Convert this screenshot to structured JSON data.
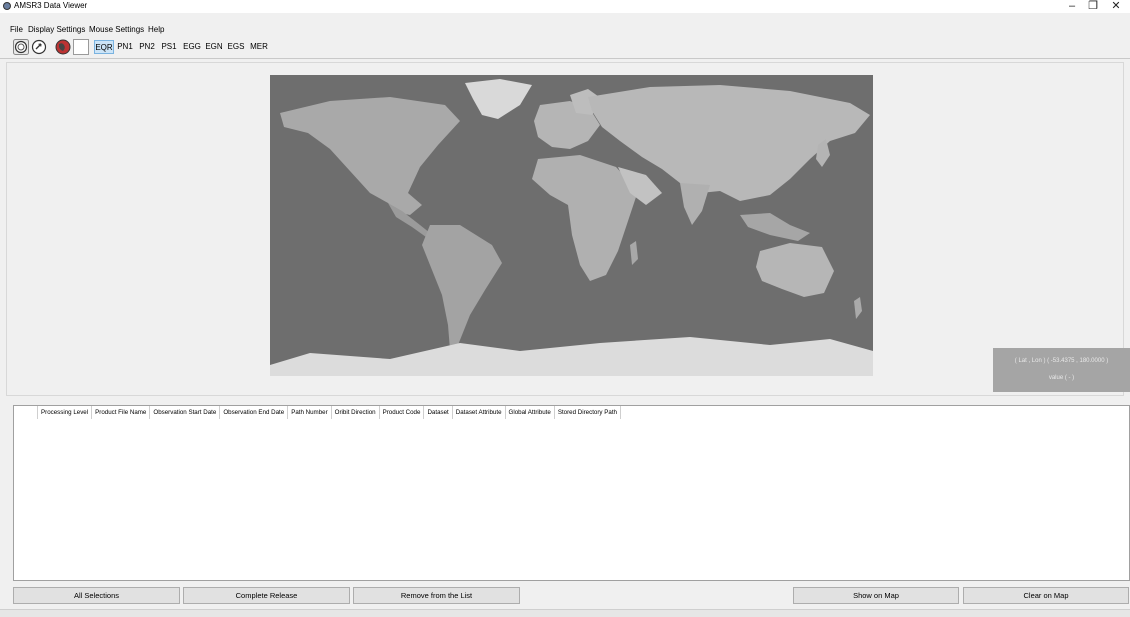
{
  "window": {
    "title": "AMSR3 Data Viewer",
    "controls": {
      "minimize": "–",
      "restore": "❐",
      "close": "✕"
    }
  },
  "menu": {
    "items": [
      {
        "label": "File"
      },
      {
        "label": "Display Settings"
      },
      {
        "label": "Mouse Settings"
      },
      {
        "label": "Help"
      }
    ]
  },
  "toolbar": {
    "icons": [
      "zoom-icon",
      "rotate-icon",
      "globe-icon",
      "blank-icon"
    ],
    "projections": [
      {
        "label": "EQR",
        "selected": true
      },
      {
        "label": "PN1"
      },
      {
        "label": "PN2"
      },
      {
        "label": "PS1"
      },
      {
        "label": "EGG"
      },
      {
        "label": "EGN"
      },
      {
        "label": "EGS"
      },
      {
        "label": "MER"
      }
    ]
  },
  "map": {
    "coord_text": "( Lat , Lon ) ( -53.4375 , 180.0000 )",
    "value_text": "value ( - )"
  },
  "table": {
    "columns": [
      "Processing Level",
      "Product File Name",
      "Observation Start Date",
      "Observation End Date",
      "Path Number",
      "Oribit Direction",
      "Product Code",
      "Dataset",
      "Dataset Attribute",
      "Global Attribute",
      "Stored Directory Path"
    ],
    "rows": []
  },
  "buttons": {
    "all_selections": "All Selections",
    "complete_release": "Complete Release",
    "remove_from_list": "Remove from the List",
    "show_on_map": "Show on Map",
    "clear_on_map": "Clear on Map"
  },
  "colors": {
    "map_ocean": "#6e6e6e",
    "selected_button": "#cce4f7",
    "coord_box": "#a5a5a5"
  }
}
